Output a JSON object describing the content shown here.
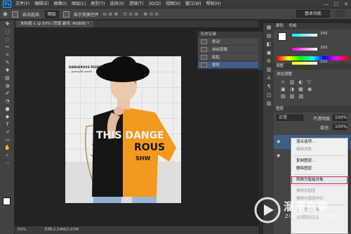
{
  "app": {
    "logo": "Ps"
  },
  "menu": [
    "文件(F)",
    "编辑(E)",
    "图像(I)",
    "图层(L)",
    "类型(Y)",
    "选择(S)",
    "滤镜(T)",
    "3D(D)",
    "视图(V)",
    "窗口(W)",
    "帮助(H)"
  ],
  "window_controls": [
    "—",
    "☐",
    "✕"
  ],
  "options": {
    "auto_select": "自动选择:",
    "layer_select": "图层",
    "show_transform": "显示变换控件",
    "workspace": "基本功能"
  },
  "document": {
    "tab": "未标题-1 @ 50% (背景 副本, RGB/8) *",
    "zoom": "50%",
    "doc_size": "文档:2.54M/2.07M"
  },
  "history": {
    "title": "历史记录",
    "items": [
      {
        "label": "移动",
        "selected": false
      },
      {
        "label": "自由变换",
        "selected": false
      },
      {
        "label": "粘贴",
        "selected": false
      },
      {
        "label": "裁剪",
        "selected": true
      }
    ]
  },
  "right_panel": {
    "color_tab": "颜色",
    "swatch_tab": "色板",
    "rgb_values": [
      "255",
      "255",
      "255"
    ],
    "adjust_tab": "调整",
    "adjust_hint": "添加调整",
    "layers_tab": "图层",
    "blend_mode": "正常",
    "opacity_label": "不透明度:",
    "opacity": "100%",
    "fill_label": "填充:",
    "fill": "100%"
  },
  "context_menu": {
    "items": [
      {
        "label": "混合选项...",
        "enabled": true,
        "highlight": false
      },
      {
        "label": "编辑调整...",
        "enabled": false,
        "highlight": false
      },
      {
        "sep": true
      },
      {
        "label": "复制图层...",
        "enabled": true,
        "highlight": false
      },
      {
        "label": "删除图层",
        "enabled": true,
        "highlight": false
      },
      {
        "sep": true
      },
      {
        "label": "转换为智能对象",
        "enabled": true,
        "highlight": true
      },
      {
        "sep": true
      },
      {
        "label": "栅格化图层",
        "enabled": false,
        "highlight": false
      },
      {
        "label": "栅格化图层样式",
        "enabled": false,
        "highlight": false
      },
      {
        "sep": true
      },
      {
        "label": "停用图层蒙版",
        "enabled": false,
        "highlight": false
      },
      {
        "label": "选择链接图层",
        "enabled": false,
        "highlight": false
      }
    ]
  },
  "shirt_text": {
    "line1": "THIS DANGE",
    "line2": "ROUS",
    "line3": "SHW"
  },
  "photo_caption": {
    "line1": "DANGEROUS PEOPLE",
    "line2": "peaceful world"
  },
  "watermark": {
    "brand": "溜溜自学",
    "url": "ZIXUE.3D66.COM"
  },
  "colors": {
    "accent": "#3f5e86",
    "highlight_border": "#d9272e",
    "shirt_orange": "#f39a1e",
    "shirt_black": "#151515"
  }
}
